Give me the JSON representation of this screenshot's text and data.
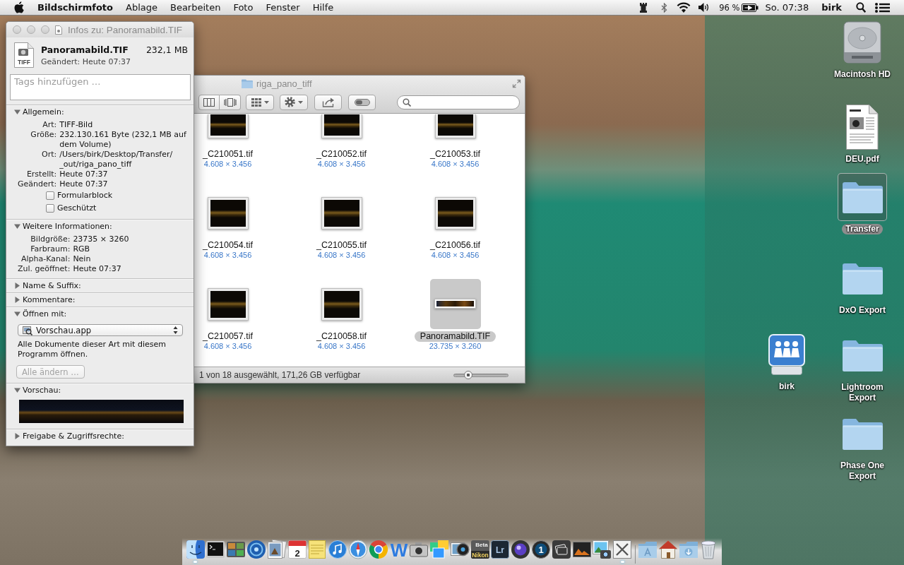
{
  "menu_bar": {
    "app_name": "Bildschirmfoto",
    "menus": [
      "Ablage",
      "Bearbeiten",
      "Foto",
      "Fenster",
      "Hilfe"
    ],
    "battery_percent": "96 %",
    "clock": "So. 07:38",
    "user": "birk"
  },
  "desktop_icons": [
    {
      "kind": "drive",
      "label": "Macintosh HD",
      "selected": false
    },
    {
      "kind": "document",
      "label": "DEU.pdf",
      "selected": false
    },
    {
      "kind": "folder",
      "label": "Transfer",
      "selected": true
    },
    {
      "kind": "folder",
      "label": "DxO Export",
      "selected": false
    },
    {
      "kind": "shared_user",
      "label": "birk",
      "selected": false
    },
    {
      "kind": "folder",
      "label": "Lightroom Export",
      "selected": false
    },
    {
      "kind": "folder",
      "label": "Phase One Export",
      "selected": false
    }
  ],
  "finder_window": {
    "title": "riga_pano_tiff",
    "items": [
      {
        "kind": "photo",
        "name": "_C210051.tif",
        "dimensions": "4.608 × 3.456",
        "selected": false
      },
      {
        "kind": "photo",
        "name": "_C210052.tif",
        "dimensions": "4.608 × 3.456",
        "selected": false
      },
      {
        "kind": "photo",
        "name": "_C210053.tif",
        "dimensions": "4.608 × 3.456",
        "selected": false
      },
      {
        "kind": "photo",
        "name": "_C210054.tif",
        "dimensions": "4.608 × 3.456",
        "selected": false
      },
      {
        "kind": "photo",
        "name": "_C210055.tif",
        "dimensions": "4.608 × 3.456",
        "selected": false
      },
      {
        "kind": "photo",
        "name": "_C210056.tif",
        "dimensions": "4.608 × 3.456",
        "selected": false
      },
      {
        "kind": "photo",
        "name": "_C210057.tif",
        "dimensions": "4.608 × 3.456",
        "selected": false
      },
      {
        "kind": "photo",
        "name": "_C210058.tif",
        "dimensions": "4.608 × 3.456",
        "selected": false
      },
      {
        "kind": "panorama",
        "name": "Panoramabild.TIF",
        "dimensions": "23.735 × 3.260",
        "selected": true
      }
    ],
    "status": "1 von 18 ausgewählt, 171,26 GB verfügbar",
    "icon_size": {
      "level": 0.22
    }
  },
  "info_window": {
    "title": "Infos zu: Panoramabild.TIF",
    "file_badge": "TIFF",
    "file_name": "Panoramabild.TIF",
    "file_size": "232,1 MB",
    "modified": "Geändert: Heute 07:37",
    "tags": {
      "placeholder": "Tags hinzufügen …"
    },
    "sections": [
      {
        "kind": "fields",
        "title": "Allgemein:",
        "expanded": true,
        "fields": [
          {
            "label": "Art:",
            "value": "TIFF-Bild"
          },
          {
            "label": "Größe:",
            "value": "232.130.161 Byte (232,1 MB auf dem Volume)"
          },
          {
            "label": "Ort:",
            "value": "/Users/birk/Desktop/Transfer/_out/riga_pano_tiff"
          },
          {
            "label": "Erstellt:",
            "value": "Heute 07:37"
          },
          {
            "label": "Geändert:",
            "value": "Heute 07:37"
          }
        ],
        "checkboxes": [
          {
            "label": "Formularblock",
            "checked": false
          },
          {
            "label": "Geschützt",
            "checked": false
          }
        ]
      },
      {
        "kind": "fields",
        "title": "Weitere Informationen:",
        "expanded": true,
        "fields": [
          {
            "label": "Bildgröße:",
            "value": "23735 × 3260"
          },
          {
            "label": "Farbraum:",
            "value": "RGB"
          },
          {
            "label": "Alpha-Kanal:",
            "value": "Nein"
          },
          {
            "label": "Zul. geöffnet:",
            "value": "Heute 07:37"
          }
        ]
      },
      {
        "title": "Name & Suffix:",
        "expanded": false
      },
      {
        "title": "Kommentare:",
        "expanded": false
      },
      {
        "kind": "open_with",
        "title": "Öffnen mit:",
        "expanded": true,
        "app": "Vorschau.app",
        "note": "Alle Dokumente dieser Art mit diesem Programm öffnen.",
        "button": {
          "label": "Alle ändern …",
          "disabled": true
        }
      },
      {
        "kind": "preview",
        "title": "Vorschau:",
        "expanded": true
      },
      {
        "title": "Freigabe & Zugriffsrechte:",
        "expanded": false
      }
    ]
  },
  "dock": {
    "apps": [
      {
        "kind": "finder",
        "running": true
      },
      {
        "kind": "terminal",
        "running": false
      },
      {
        "kind": "photo_tile",
        "running": false
      },
      {
        "kind": "ring",
        "running": false
      },
      {
        "kind": "preview",
        "running": false
      },
      {
        "kind": "calendar",
        "text": "2",
        "running": false
      },
      {
        "kind": "notes",
        "running": false
      },
      {
        "kind": "music",
        "running": false
      },
      {
        "kind": "compass",
        "running": false
      },
      {
        "kind": "color_wheel",
        "running": false
      },
      {
        "kind": "letter",
        "text": "W",
        "running": false
      },
      {
        "kind": "camera",
        "running": false
      },
      {
        "kind": "collage",
        "running": false
      },
      {
        "kind": "lens_photo",
        "running": false
      },
      {
        "kind": "labeled_tile",
        "badge": "Beta",
        "text": "Nikon",
        "running": false
      },
      {
        "kind": "letter_tile",
        "text": "Lr",
        "running": false
      },
      {
        "kind": "lens",
        "running": false
      },
      {
        "kind": "number_disc",
        "text": "1",
        "running": false
      },
      {
        "kind": "cards",
        "running": false
      },
      {
        "kind": "dark_photo",
        "running": false
      },
      {
        "kind": "photo_camera",
        "running": false
      },
      {
        "kind": "tools",
        "running": true
      }
    ],
    "stacks": [
      {
        "kind": "apps_folder"
      },
      {
        "kind": "home"
      },
      {
        "kind": "downloads_folder"
      },
      {
        "kind": "trash"
      }
    ]
  }
}
